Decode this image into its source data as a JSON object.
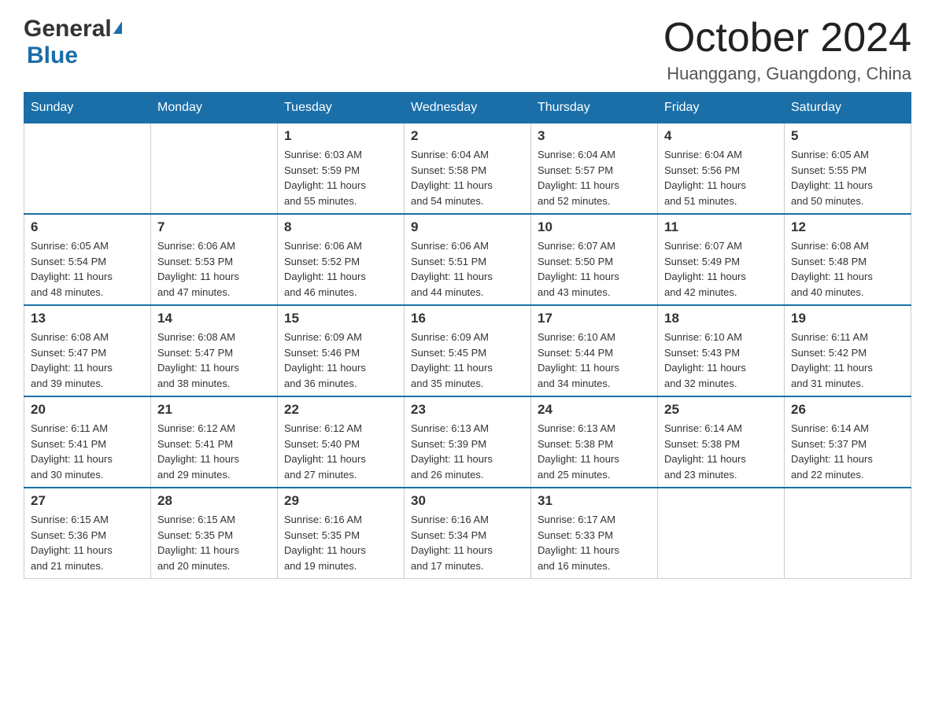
{
  "header": {
    "logo_general": "General",
    "logo_blue": "Blue",
    "month_title": "October 2024",
    "location": "Huanggang, Guangdong, China"
  },
  "weekdays": [
    "Sunday",
    "Monday",
    "Tuesday",
    "Wednesday",
    "Thursday",
    "Friday",
    "Saturday"
  ],
  "weeks": [
    [
      {
        "day": "",
        "info": ""
      },
      {
        "day": "",
        "info": ""
      },
      {
        "day": "1",
        "info": "Sunrise: 6:03 AM\nSunset: 5:59 PM\nDaylight: 11 hours\nand 55 minutes."
      },
      {
        "day": "2",
        "info": "Sunrise: 6:04 AM\nSunset: 5:58 PM\nDaylight: 11 hours\nand 54 minutes."
      },
      {
        "day": "3",
        "info": "Sunrise: 6:04 AM\nSunset: 5:57 PM\nDaylight: 11 hours\nand 52 minutes."
      },
      {
        "day": "4",
        "info": "Sunrise: 6:04 AM\nSunset: 5:56 PM\nDaylight: 11 hours\nand 51 minutes."
      },
      {
        "day": "5",
        "info": "Sunrise: 6:05 AM\nSunset: 5:55 PM\nDaylight: 11 hours\nand 50 minutes."
      }
    ],
    [
      {
        "day": "6",
        "info": "Sunrise: 6:05 AM\nSunset: 5:54 PM\nDaylight: 11 hours\nand 48 minutes."
      },
      {
        "day": "7",
        "info": "Sunrise: 6:06 AM\nSunset: 5:53 PM\nDaylight: 11 hours\nand 47 minutes."
      },
      {
        "day": "8",
        "info": "Sunrise: 6:06 AM\nSunset: 5:52 PM\nDaylight: 11 hours\nand 46 minutes."
      },
      {
        "day": "9",
        "info": "Sunrise: 6:06 AM\nSunset: 5:51 PM\nDaylight: 11 hours\nand 44 minutes."
      },
      {
        "day": "10",
        "info": "Sunrise: 6:07 AM\nSunset: 5:50 PM\nDaylight: 11 hours\nand 43 minutes."
      },
      {
        "day": "11",
        "info": "Sunrise: 6:07 AM\nSunset: 5:49 PM\nDaylight: 11 hours\nand 42 minutes."
      },
      {
        "day": "12",
        "info": "Sunrise: 6:08 AM\nSunset: 5:48 PM\nDaylight: 11 hours\nand 40 minutes."
      }
    ],
    [
      {
        "day": "13",
        "info": "Sunrise: 6:08 AM\nSunset: 5:47 PM\nDaylight: 11 hours\nand 39 minutes."
      },
      {
        "day": "14",
        "info": "Sunrise: 6:08 AM\nSunset: 5:47 PM\nDaylight: 11 hours\nand 38 minutes."
      },
      {
        "day": "15",
        "info": "Sunrise: 6:09 AM\nSunset: 5:46 PM\nDaylight: 11 hours\nand 36 minutes."
      },
      {
        "day": "16",
        "info": "Sunrise: 6:09 AM\nSunset: 5:45 PM\nDaylight: 11 hours\nand 35 minutes."
      },
      {
        "day": "17",
        "info": "Sunrise: 6:10 AM\nSunset: 5:44 PM\nDaylight: 11 hours\nand 34 minutes."
      },
      {
        "day": "18",
        "info": "Sunrise: 6:10 AM\nSunset: 5:43 PM\nDaylight: 11 hours\nand 32 minutes."
      },
      {
        "day": "19",
        "info": "Sunrise: 6:11 AM\nSunset: 5:42 PM\nDaylight: 11 hours\nand 31 minutes."
      }
    ],
    [
      {
        "day": "20",
        "info": "Sunrise: 6:11 AM\nSunset: 5:41 PM\nDaylight: 11 hours\nand 30 minutes."
      },
      {
        "day": "21",
        "info": "Sunrise: 6:12 AM\nSunset: 5:41 PM\nDaylight: 11 hours\nand 29 minutes."
      },
      {
        "day": "22",
        "info": "Sunrise: 6:12 AM\nSunset: 5:40 PM\nDaylight: 11 hours\nand 27 minutes."
      },
      {
        "day": "23",
        "info": "Sunrise: 6:13 AM\nSunset: 5:39 PM\nDaylight: 11 hours\nand 26 minutes."
      },
      {
        "day": "24",
        "info": "Sunrise: 6:13 AM\nSunset: 5:38 PM\nDaylight: 11 hours\nand 25 minutes."
      },
      {
        "day": "25",
        "info": "Sunrise: 6:14 AM\nSunset: 5:38 PM\nDaylight: 11 hours\nand 23 minutes."
      },
      {
        "day": "26",
        "info": "Sunrise: 6:14 AM\nSunset: 5:37 PM\nDaylight: 11 hours\nand 22 minutes."
      }
    ],
    [
      {
        "day": "27",
        "info": "Sunrise: 6:15 AM\nSunset: 5:36 PM\nDaylight: 11 hours\nand 21 minutes."
      },
      {
        "day": "28",
        "info": "Sunrise: 6:15 AM\nSunset: 5:35 PM\nDaylight: 11 hours\nand 20 minutes."
      },
      {
        "day": "29",
        "info": "Sunrise: 6:16 AM\nSunset: 5:35 PM\nDaylight: 11 hours\nand 19 minutes."
      },
      {
        "day": "30",
        "info": "Sunrise: 6:16 AM\nSunset: 5:34 PM\nDaylight: 11 hours\nand 17 minutes."
      },
      {
        "day": "31",
        "info": "Sunrise: 6:17 AM\nSunset: 5:33 PM\nDaylight: 11 hours\nand 16 minutes."
      },
      {
        "day": "",
        "info": ""
      },
      {
        "day": "",
        "info": ""
      }
    ]
  ]
}
